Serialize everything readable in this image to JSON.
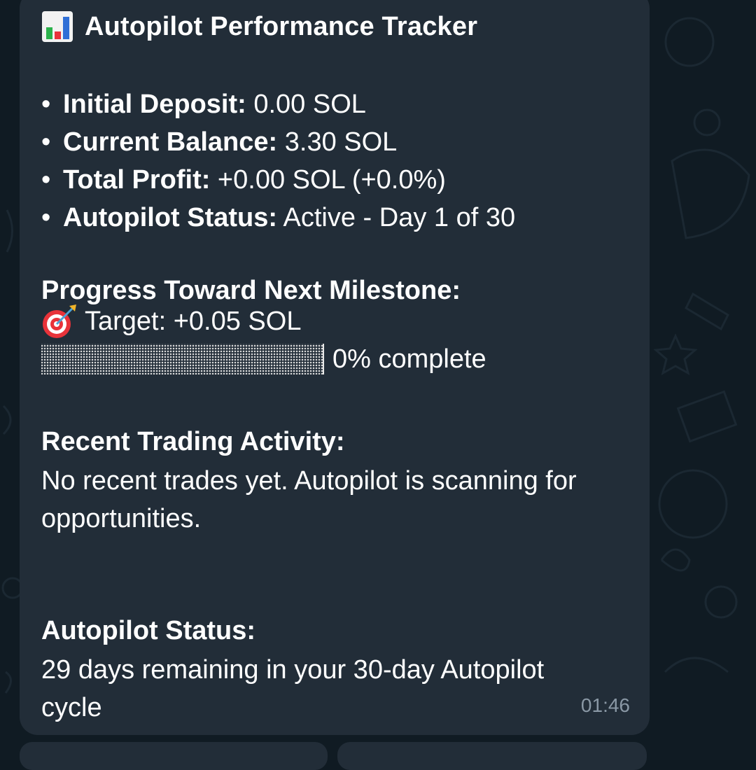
{
  "message": {
    "title": "Autopilot Performance Tracker",
    "stats": [
      {
        "label": "Initial Deposit:",
        "value": " 0.00 SOL"
      },
      {
        "label": "Current Balance:",
        "value": " 3.30 SOL"
      },
      {
        "label": "Total Profit:",
        "value": " +0.00 SOL (+0.0%)"
      },
      {
        "label": "Autopilot Status:",
        "value": " Active - Day 1 of 30"
      }
    ],
    "milestone": {
      "heading": "Progress Toward Next Milestone:",
      "target": "Target: +0.05 SOL",
      "progress_label": "0% complete",
      "progress_fraction": 0.0
    },
    "activity": {
      "heading": "Recent Trading Activity:",
      "line1": "No recent trades yet. Autopilot is scanning for",
      "line2": "opportunities."
    },
    "status": {
      "heading": "Autopilot Status:",
      "line1": "29 days remaining in your 30-day Autopilot",
      "line2": "cycle"
    },
    "time": "01:46"
  },
  "icons": {
    "title_icon": "bar-chart-emoji-icon",
    "target_icon": "direct-hit-target-emoji-icon"
  },
  "colors": {
    "bubble": "#222d38",
    "background": "#101b23",
    "text": "#ffffff",
    "timestamp": "#8a98a5"
  }
}
